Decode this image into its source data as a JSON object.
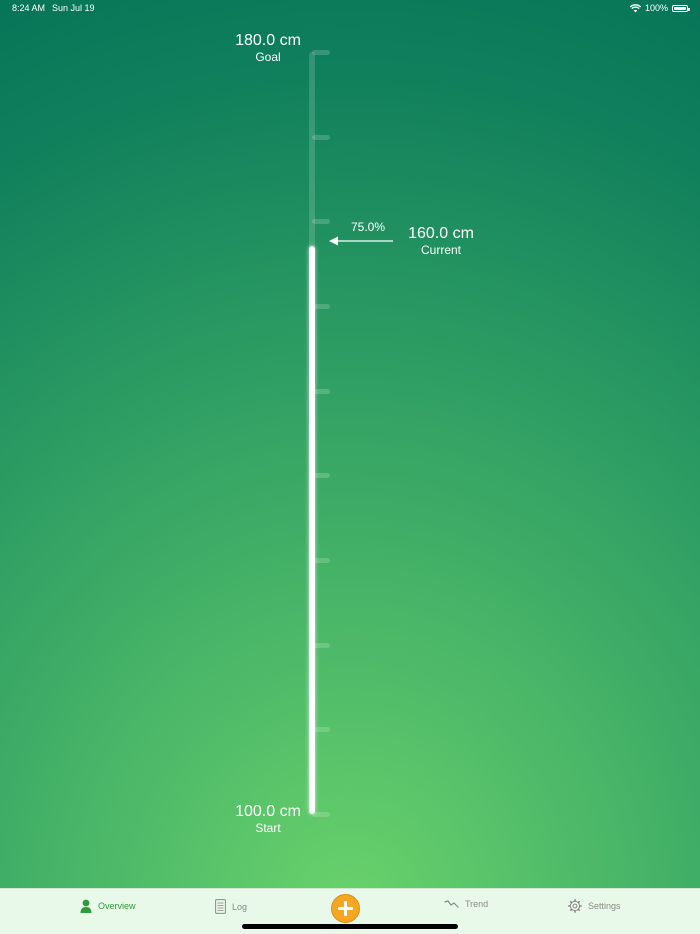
{
  "status_bar": {
    "time": "8:24 AM",
    "date": "Sun Jul 19",
    "battery_percent": "100%",
    "wifi_icon": "wifi-icon",
    "battery_icon": "battery-icon"
  },
  "progress": {
    "goal_value": "180.0 cm",
    "goal_label": "Goal",
    "start_value": "100.0 cm",
    "start_label": "Start",
    "current_value": "160.0 cm",
    "current_label": "Current",
    "percent_text": "75.0%",
    "fraction": 0.75,
    "tick_count": 10
  },
  "tab_bar": {
    "overview_label": "Overview",
    "log_label": "Log",
    "trend_label": "Trend",
    "settings_label": "Settings",
    "active_tab": "overview",
    "active_color": "#2d9b3a",
    "inactive_color": "#8a8a8a",
    "add_color": "#f5a623"
  }
}
